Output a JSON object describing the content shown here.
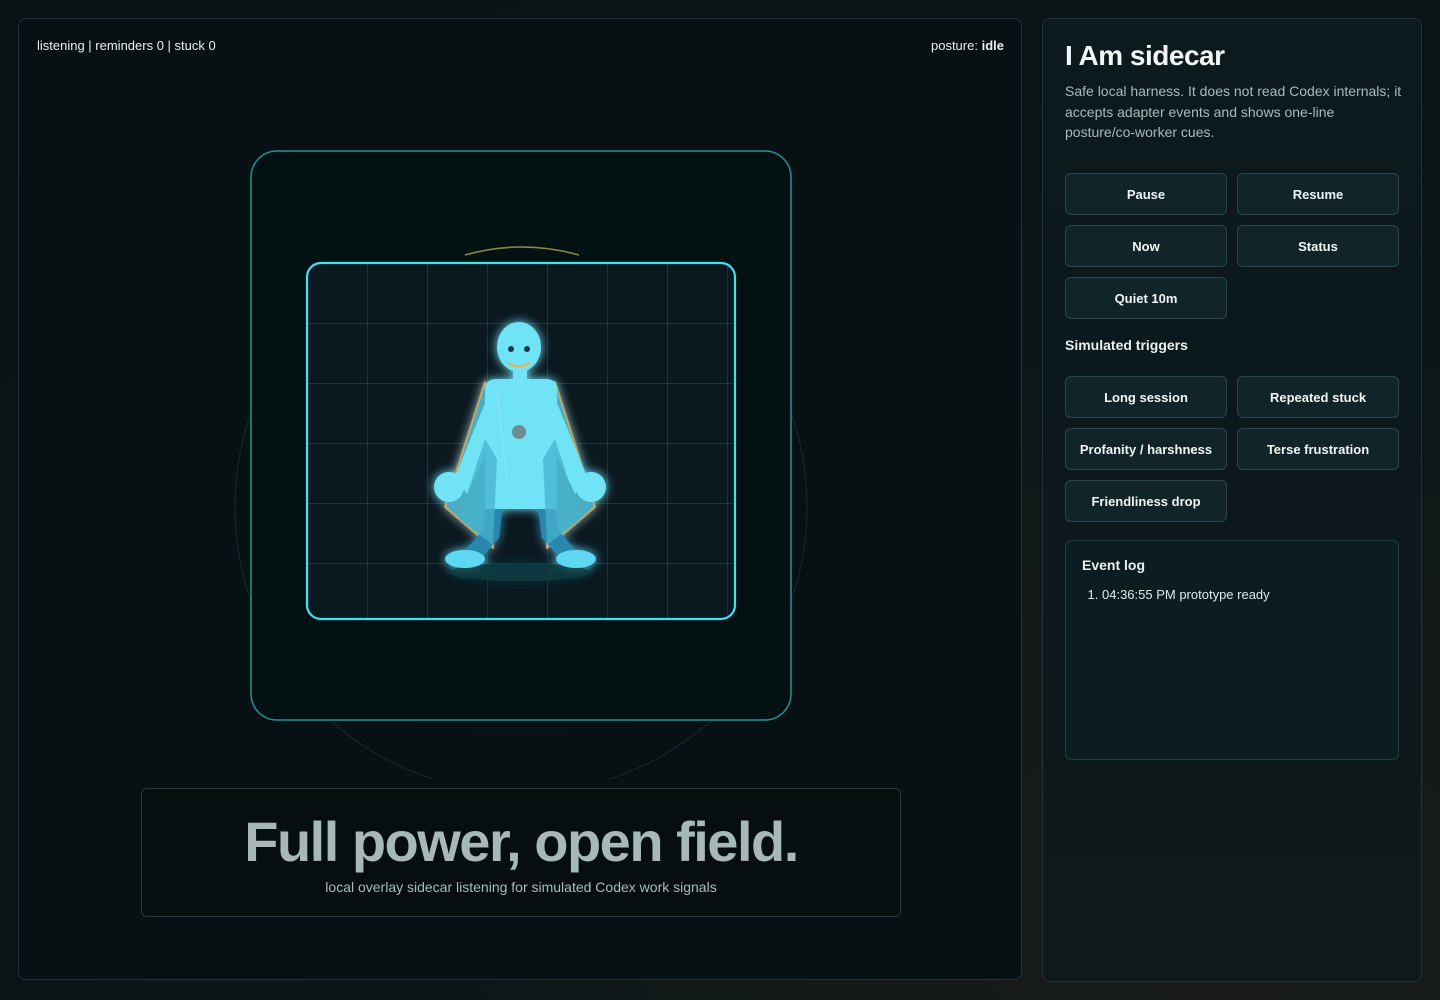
{
  "stage": {
    "status_line": "listening | reminders 0 | stuck 0",
    "posture_label": "posture:",
    "posture_value": "idle",
    "caption_title": "Full power, open field.",
    "caption_subtitle": "local overlay sidecar listening for simulated Codex work signals"
  },
  "panel": {
    "title": "I Am sidecar",
    "description": "Safe local harness. It does not read Codex internals; it accepts adapter events and shows one-line posture/co-worker cues.",
    "controls": {
      "pause": "Pause",
      "resume": "Resume",
      "now": "Now",
      "status": "Status",
      "quiet": "Quiet 10m"
    },
    "triggers_label": "Simulated triggers",
    "triggers": {
      "long_session": "Long session",
      "repeated_stuck": "Repeated stuck",
      "profanity": "Profanity / harshness",
      "terse": "Terse frustration",
      "friendliness": "Friendliness drop"
    },
    "event_log": {
      "title": "Event log",
      "entries": [
        "04:36:55 PM prototype ready"
      ]
    }
  },
  "colors": {
    "accent": "#3fe0f2",
    "figure": "#6fe3f7",
    "figure_shadow": "#35a8c4",
    "cape_outline": "#c9a560",
    "smile": "#e9b548"
  }
}
